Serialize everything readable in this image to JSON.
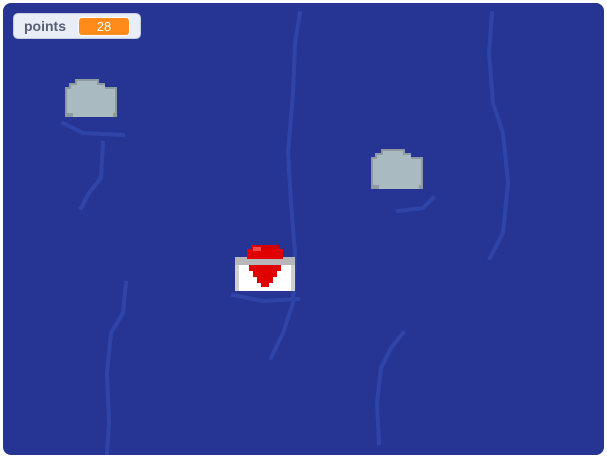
{
  "variable_monitor": {
    "label": "points",
    "value": "28"
  },
  "stage": {
    "background_color": "#263593",
    "ripple_color": "#2f44a8",
    "sprites": [
      {
        "name": "rock-1",
        "icon": "rock-icon",
        "color": "#a9bac0"
      },
      {
        "name": "rock-2",
        "icon": "rock-icon",
        "color": "#a9bac0"
      },
      {
        "name": "heart-envelope",
        "icon": "heart-envelope-icon",
        "color": "#e00000"
      }
    ]
  }
}
